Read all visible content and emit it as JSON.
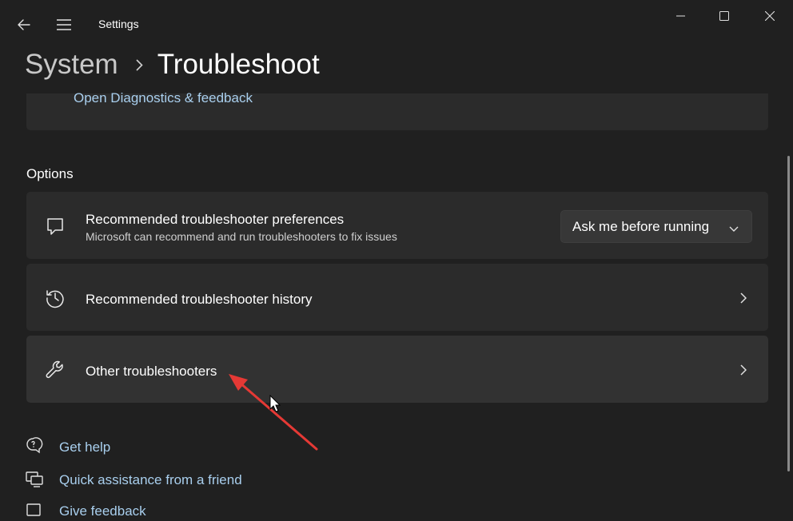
{
  "window": {
    "title": "Settings",
    "minimize_icon": "minimize-icon",
    "maximize_icon": "maximize-icon",
    "close_icon": "close-icon"
  },
  "nav": {
    "back_icon": "back-arrow-icon",
    "menu_icon": "hamburger-menu-icon"
  },
  "breadcrumb": {
    "parent": "System",
    "separator_icon": "chevron-right-icon",
    "current": "Troubleshoot"
  },
  "diagnostics_card": {
    "link": "Open Diagnostics & feedback"
  },
  "options": {
    "header": "Options",
    "items": [
      {
        "icon": "chat-bubble-icon",
        "title": "Recommended troubleshooter preferences",
        "description": "Microsoft can recommend and run troubleshooters to fix issues",
        "dropdown_value": "Ask me before running"
      },
      {
        "icon": "history-icon",
        "title": "Recommended troubleshooter history"
      },
      {
        "icon": "wrench-icon",
        "title": "Other troubleshooters"
      }
    ]
  },
  "help_links": [
    {
      "icon": "help-chat-icon",
      "label": "Get help"
    },
    {
      "icon": "remote-assist-icon",
      "label": "Quick assistance from a friend"
    },
    {
      "icon": "feedback-icon",
      "label": "Give feedback"
    }
  ],
  "colors": {
    "background": "#202020",
    "card": "#2b2b2b",
    "link": "#a9cfee",
    "annotation_arrow": "#e53935"
  }
}
